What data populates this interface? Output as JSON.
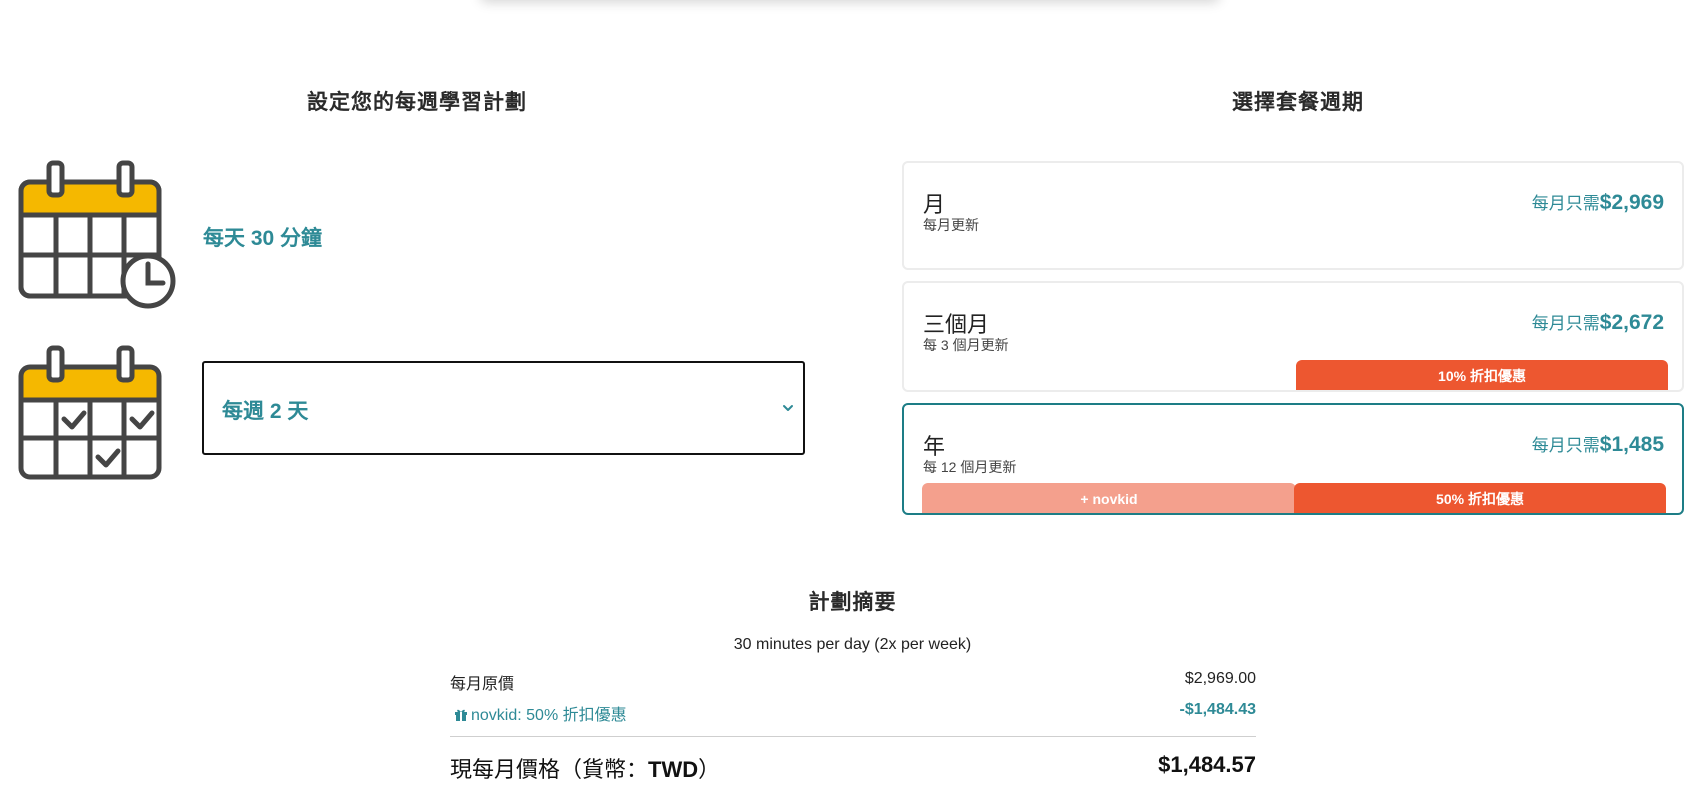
{
  "weekly_plan": {
    "title": "設定您的每週學習計劃",
    "minutes_label": "每天 30 分鐘",
    "days_value": "每週 2 天"
  },
  "plan_period": {
    "title": "選擇套餐週期",
    "plans": [
      {
        "name": "月",
        "renewal": "每月更新",
        "price_prefix": "每月只需",
        "price": "$2,969"
      },
      {
        "name": "三個月",
        "renewal": "每 3 個月更新",
        "price_prefix": "每月只需",
        "price": "$2,672",
        "discount_badge": "10% 折扣優惠"
      },
      {
        "name": "年",
        "renewal": "每 12 個月更新",
        "price_prefix": "每月只需",
        "price": "$1,485",
        "promo_badge": "+ novkid",
        "discount_badge": "50% 折扣優惠",
        "selected": true
      }
    ]
  },
  "summary": {
    "title": "計劃摘要",
    "subtitle": "30 minutes per day (2x per week)",
    "original_label": "每月原價",
    "original_value": "$2,969.00",
    "discount_label": "novkid: 50% 折扣優惠",
    "discount_value": "-$1,484.43",
    "total_label_pre": "現每月價格（貨幣：",
    "total_currency": "TWD",
    "total_label_post": "）",
    "total_value": "$1,484.57"
  },
  "colors": {
    "accent": "#2e8a96",
    "selected_border": "#1d7d86",
    "discount_badge": "#ed5730",
    "promo_badge": "#f4a08d",
    "calendar_header": "#f5b800",
    "calendar_outline": "#454545"
  },
  "icons": [
    "calendar-clock-icon",
    "calendar-check-icon",
    "chevron-down-icon",
    "gift-icon"
  ]
}
